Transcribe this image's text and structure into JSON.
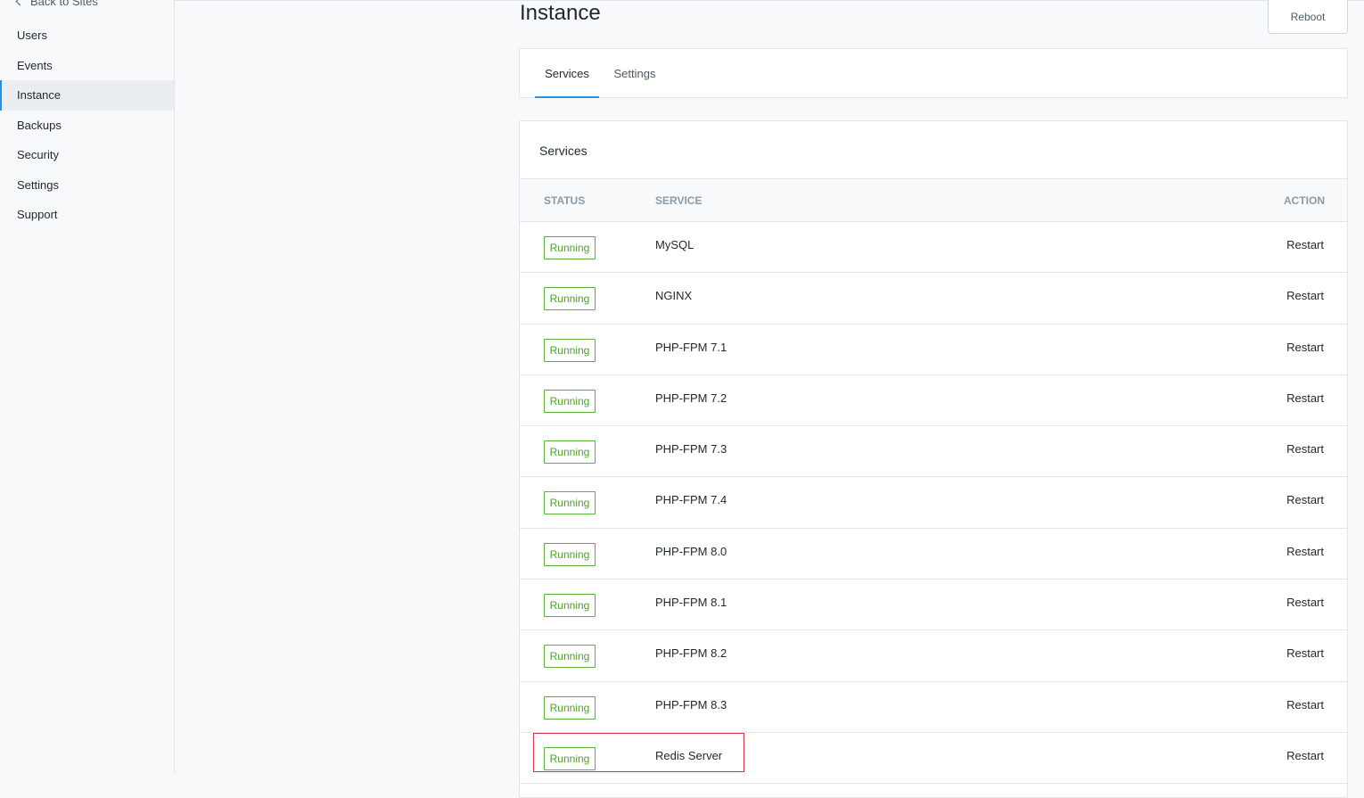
{
  "sidebar": {
    "back_label": "Back to Sites",
    "items": [
      {
        "label": "Users",
        "active": false
      },
      {
        "label": "Events",
        "active": false
      },
      {
        "label": "Instance",
        "active": true
      },
      {
        "label": "Backups",
        "active": false
      },
      {
        "label": "Security",
        "active": false
      },
      {
        "label": "Settings",
        "active": false
      },
      {
        "label": "Support",
        "active": false
      }
    ]
  },
  "header": {
    "title": "Instance",
    "reboot_label": "Reboot"
  },
  "tabs": [
    {
      "label": "Services",
      "active": true
    },
    {
      "label": "Settings",
      "active": false
    }
  ],
  "services_card": {
    "title": "Services",
    "columns": {
      "status": "STATUS",
      "service": "SERVICE",
      "action": "ACTION"
    },
    "rows": [
      {
        "status": "Running",
        "service": "MySQL",
        "action": "Restart"
      },
      {
        "status": "Running",
        "service": "NGINX",
        "action": "Restart"
      },
      {
        "status": "Running",
        "service": "PHP-FPM 7.1",
        "action": "Restart"
      },
      {
        "status": "Running",
        "service": "PHP-FPM 7.2",
        "action": "Restart"
      },
      {
        "status": "Running",
        "service": "PHP-FPM 7.3",
        "action": "Restart"
      },
      {
        "status": "Running",
        "service": "PHP-FPM 7.4",
        "action": "Restart"
      },
      {
        "status": "Running",
        "service": "PHP-FPM 8.0",
        "action": "Restart"
      },
      {
        "status": "Running",
        "service": "PHP-FPM 8.1",
        "action": "Restart"
      },
      {
        "status": "Running",
        "service": "PHP-FPM 8.2",
        "action": "Restart"
      },
      {
        "status": "Running",
        "service": "PHP-FPM 8.3",
        "action": "Restart"
      },
      {
        "status": "Running",
        "service": "Redis Server",
        "action": "Restart"
      }
    ]
  },
  "colors": {
    "accent": "#2490ef",
    "running": "#4ca32a",
    "highlight": "#d9304a"
  }
}
